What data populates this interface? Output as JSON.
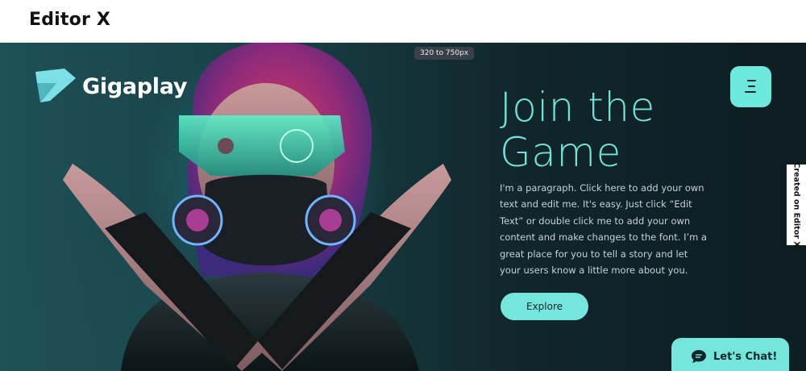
{
  "app": {
    "brand": "Editor X"
  },
  "hero": {
    "breakpoint_tag": "320 to 750px",
    "logo_text": "Gigaplay",
    "title_line1": "Join the",
    "title_line2": "Game",
    "paragraph": "I'm a paragraph. Click here to add your own text and edit me. It's easy. Just click “Edit Text” or double click me to add your own content and make changes to the font. I’m a great place for you to tell a story and let your users know a little more about you.",
    "explore_label": "Explore",
    "created_tag": "Created on Editor X",
    "chat_label": "Let's Chat!"
  },
  "colors": {
    "accent": "#74e6db",
    "hero_bg": "#10262b",
    "title": "#6fe3d7"
  },
  "icons": {
    "logo": "gigaplay-logo-icon",
    "menu": "hamburger-menu-icon",
    "chat": "chat-bubble-icon"
  }
}
